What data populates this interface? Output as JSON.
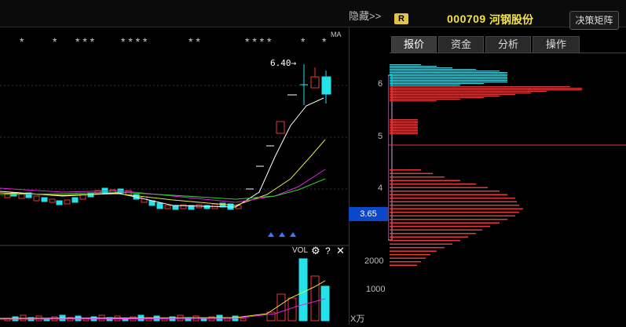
{
  "header": {
    "hide_label": "隐藏>>",
    "badge": "R",
    "code": "000709",
    "name": "河钢股份",
    "decision_button": "决策矩阵"
  },
  "tabs": [
    {
      "label": "报价",
      "active": true
    },
    {
      "label": "资金",
      "active": false
    },
    {
      "label": "分析",
      "active": false
    },
    {
      "label": "操作",
      "active": false
    }
  ],
  "price_axis": [
    "6",
    "5",
    "4"
  ],
  "current_price": "3.65",
  "high_marker": "6.40",
  "ma_label": "MA",
  "volume": {
    "title": "VOL",
    "unit": "X万",
    "axis": [
      "2000",
      "1000"
    ]
  },
  "colors": {
    "up": "#e6393d",
    "down": "#24e1ec",
    "ma5": "#ffffff",
    "ma10": "#e6e645",
    "ma20": "#e022e0",
    "ma30": "#2fd12f",
    "background": "#000000",
    "price_highlight": "#0b47c7"
  },
  "stars": [
    "*",
    "*",
    "* * *",
    "* * * *",
    "* *",
    "* * * *",
    "*",
    "*"
  ]
}
